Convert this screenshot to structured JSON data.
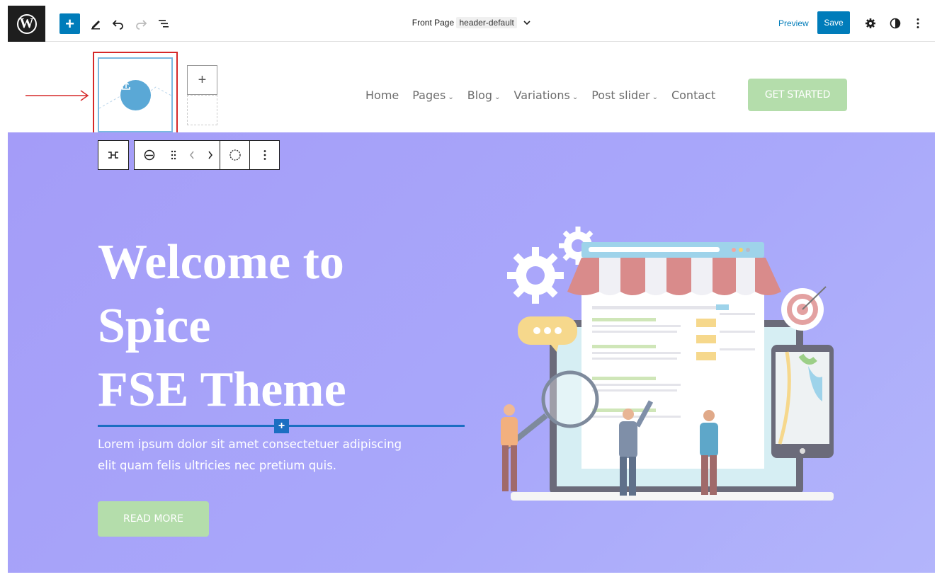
{
  "toolbar": {
    "add_label": "+",
    "document_title": "Front Page",
    "template_name": "header-default",
    "preview_label": "Preview",
    "save_label": "Save",
    "icons": [
      "wordpress-logo",
      "edit-pencil",
      "undo",
      "redo",
      "list-view",
      "settings-gear",
      "styles-halfcircle",
      "more-vertical"
    ]
  },
  "header": {
    "add_block_label": "+",
    "nav": [
      {
        "label": "Home",
        "has_submenu": false
      },
      {
        "label": "Pages",
        "has_submenu": true
      },
      {
        "label": "Blog",
        "has_submenu": true
      },
      {
        "label": "Variations",
        "has_submenu": true
      },
      {
        "label": "Post slider",
        "has_submenu": true
      },
      {
        "label": "Contact",
        "has_submenu": false
      }
    ],
    "cta_label": "GET STARTED",
    "submenu_chevron": "⌄"
  },
  "block_toolbar": {
    "icons": [
      "transform-icon",
      "site-logo-icon",
      "drag-handle-icon",
      "move-left-icon",
      "move-right-icon",
      "circle-crop-icon",
      "more-options-icon"
    ]
  },
  "hero": {
    "title_lines": [
      "Welcome to",
      "Spice",
      "FSE Theme"
    ],
    "insert_label": "+",
    "text_lines": [
      "Lorem ipsum dolor sit amet consectetuer adipiscing",
      "elit quam felis ultricies nec pretium quis."
    ],
    "button_label": "READ MORE"
  },
  "colors": {
    "wp_blue": "#007cba",
    "hero_purple": "#a9a8fa",
    "cta_green": "#b4ddab",
    "highlight_red": "#d62828"
  }
}
